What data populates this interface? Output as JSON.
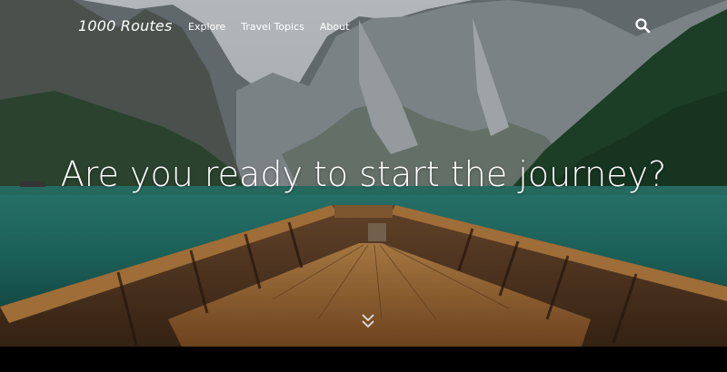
{
  "site": {
    "logo": "1000 Routes"
  },
  "nav": {
    "items": [
      {
        "label": "Explore"
      },
      {
        "label": "Travel Topics"
      },
      {
        "label": "About"
      }
    ],
    "search_icon": "search-icon"
  },
  "hero": {
    "headline": "Are you ready to start the journey?",
    "scroll_icon": "chevron-down-icon"
  }
}
